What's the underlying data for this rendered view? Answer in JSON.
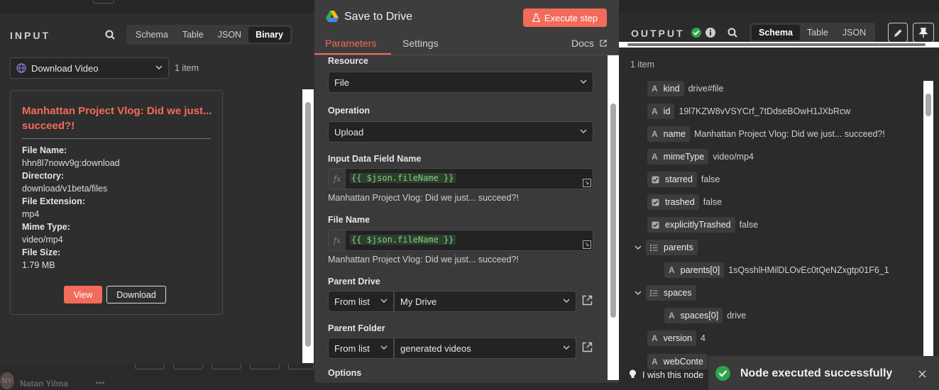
{
  "input": {
    "title": "INPUT",
    "view_tabs": [
      "Schema",
      "Table",
      "JSON",
      "Binary"
    ],
    "active_tab": "Binary",
    "source_select": "Download Video",
    "item_count": "1 item",
    "card": {
      "title": "Manhattan Project Vlog: Did we just... succeed?!",
      "fields": [
        {
          "label": "File Name:",
          "value": "hhn8l7nowv9g:download"
        },
        {
          "label": "Directory:",
          "value": "download/v1beta/files"
        },
        {
          "label": "File Extension:",
          "value": "mp4"
        },
        {
          "label": "Mime Type:",
          "value": "video/mp4"
        },
        {
          "label": "File Size:",
          "value": "1.79 MB"
        }
      ],
      "view_label": "View",
      "download_label": "Download"
    }
  },
  "node": {
    "title": "Save to Drive",
    "execute_label": "Execute step",
    "tabs": {
      "parameters": "Parameters",
      "settings": "Settings",
      "docs": "Docs"
    },
    "resource": {
      "label": "Resource",
      "value": "File"
    },
    "operation": {
      "label": "Operation",
      "value": "Upload"
    },
    "input_field": {
      "label": "Input Data Field Name",
      "expression": "{{ $json.fileName }}",
      "preview": "Manhattan Project Vlog:  Did we just... succeed?!"
    },
    "file_name": {
      "label": "File Name",
      "expression": "{{ $json.fileName }}",
      "preview": "Manhattan Project Vlog:  Did we just... succeed?!"
    },
    "parent_drive": {
      "label": "Parent Drive",
      "mode": "From list",
      "value": "My Drive"
    },
    "parent_folder": {
      "label": "Parent Folder",
      "mode": "From list",
      "value": "generated videos"
    },
    "options_label": "Options"
  },
  "output": {
    "title": "OUTPUT",
    "view_tabs": [
      "Schema",
      "Table",
      "JSON"
    ],
    "active_tab": "Schema",
    "item_count": "1 item",
    "rows": [
      {
        "type": "A",
        "key": "kind",
        "value": "drive#file"
      },
      {
        "type": "A",
        "key": "id",
        "value": "19l7KZW8vVSYCrf_7tDdseBOwH1JXbRcw"
      },
      {
        "type": "A",
        "key": "name",
        "value": "Manhattan Project Vlog: Did we just... succeed?!"
      },
      {
        "type": "A",
        "key": "mimeType",
        "value": "video/mp4"
      },
      {
        "type": "check",
        "key": "starred",
        "value": "false"
      },
      {
        "type": "check",
        "key": "trashed",
        "value": "false"
      },
      {
        "type": "check",
        "key": "explicitlyTrashed",
        "value": "false"
      },
      {
        "type": "list",
        "key": "parents",
        "value": ""
      },
      {
        "type": "A",
        "key": "parents[0]",
        "value": "1sQsshlHMilDLOvEc0tQeNZxgtp01F6_1"
      },
      {
        "type": "list",
        "key": "spaces",
        "value": ""
      },
      {
        "type": "A",
        "key": "spaces[0]",
        "value": "drive"
      },
      {
        "type": "A",
        "key": "version",
        "value": "4"
      },
      {
        "type": "A",
        "key": "webConte",
        "value": ""
      }
    ]
  },
  "bottom": {
    "user_initials": "NY",
    "user_name": "Natan Yilma",
    "feedback": "I wish this node",
    "toast": "Node executed successfully"
  },
  "colors": {
    "accent": "#f26b5b",
    "success": "#2ea44f"
  }
}
